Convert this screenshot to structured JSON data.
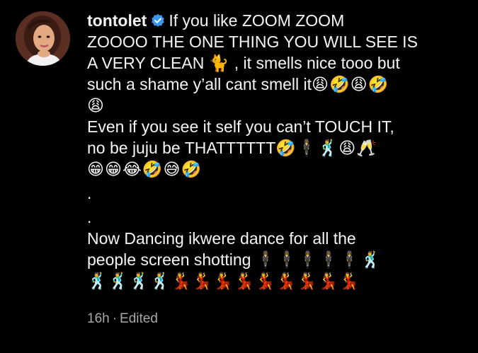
{
  "comment": {
    "username": "tontolet",
    "verified": true,
    "text_line1": "If you like ZOOM ZOOM",
    "text_line2": "ZOOOO THE ONE THING YOU WILL SEE IS",
    "text_line3_a": "A VERY CLEAN",
    "text_line3_emoji": "🐈",
    "text_line3_b": ", it smells nice tooo but",
    "text_line4": "such a shame y’all cant smell it",
    "emoji_line4": "😩🤣😩🤣",
    "emoji_line5": "😩",
    "text_line6": "Even if you see it self you can’t TOUCH IT,",
    "text_line7": "no be juju be THATTTTTT",
    "emoji_line7": "🤣🕴🕺😩🥂",
    "emoji_line8": "😁😁😂🤣😅🤣",
    "dot1": ".",
    "dot2": ".",
    "text_line11": "Now Dancing ikwere dance for all the",
    "text_line12": "people screen shotting",
    "emoji_line12": "🕴🕴🕴🕴🕴🕺",
    "emoji_line13": "🕺🕺🕺🕺💃💃💃💃💃💃💃💃💃",
    "time": "16h",
    "separator": "·",
    "edited": "Edited"
  },
  "colors": {
    "background": "#000000",
    "text": "#f5f5f5",
    "meta": "#a8a8a8",
    "verified_badge": "#3897f0"
  },
  "icons": {
    "avatar": "profile-photo",
    "verified": "verified-badge-icon"
  }
}
